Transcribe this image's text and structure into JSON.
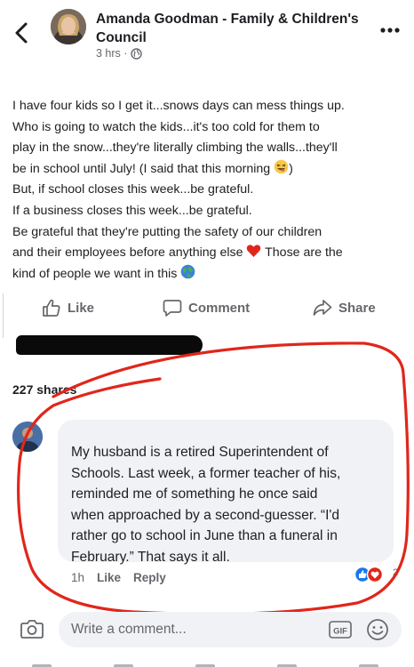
{
  "post": {
    "page_name": "Amanda Goodman - Family & Children's Council",
    "time": "3 hrs ·",
    "lines": [
      "I have four kids so I get it...snows days can mess things up.",
      "Who is going to watch the kids...it's too cold for them to",
      "play in the snow...they're literally climbing the walls...they'll",
      "be in school until July! (I said that this morning",
      ")",
      "But, if school closes this week...be grateful.",
      "If a business closes this week...be grateful.",
      "Be grateful that they're putting the safety of our children",
      "and their employees before anything else",
      "Those are the",
      "kind of people we want in this"
    ]
  },
  "actions": {
    "like": "Like",
    "comment": "Comment",
    "share": "Share"
  },
  "shares": {
    "count": "227 shares"
  },
  "comment": {
    "lines": [
      "My husband is a retired Superintendent of",
      "Schools. Last week, a former teacher of his,",
      "reminded me of something he once said",
      "when approached by a second-guesser. “I'd",
      "rather go to school in June than a funeral in",
      "February.” That says it all."
    ],
    "time": "1h",
    "like": "Like",
    "reply": "Reply",
    "reaction_count": "2"
  },
  "composer": {
    "placeholder": "Write a comment...",
    "gif": "GIF"
  },
  "colors": {
    "accent_blue": "#1877f2",
    "annotation_red": "#e0261b",
    "text_primary": "#1c1e21",
    "text_secondary": "#65676b",
    "bubble_bg": "#f0f2f5"
  },
  "icons": {
    "back": "chevron-left-icon",
    "more": "ellipsis-icon",
    "audience": "globe-icon",
    "like": "thumbs-up-icon",
    "comment": "speech-bubble-icon",
    "share": "share-arrow-icon",
    "camera": "camera-icon",
    "gif": "gif-icon",
    "emoji": "smiley-icon"
  }
}
